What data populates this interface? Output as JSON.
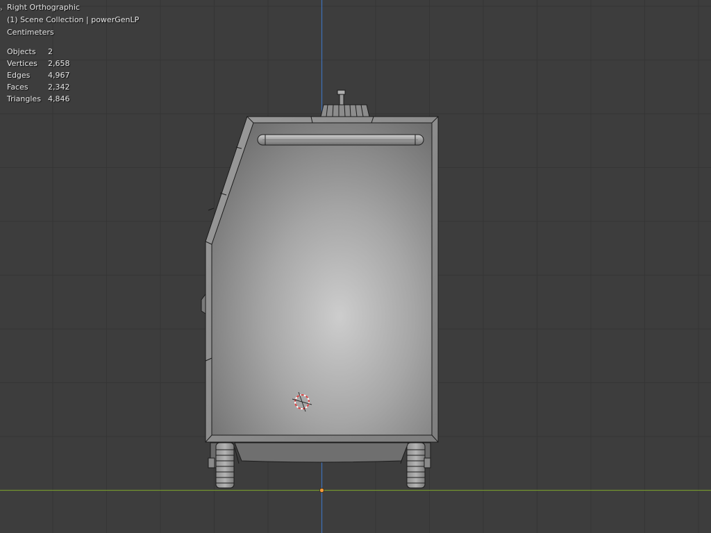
{
  "viewport": {
    "view_name": "Right Orthographic",
    "collection_line": "(1) Scene Collection | powerGenLP",
    "units": "Centimeters",
    "stats": [
      {
        "name": "Objects",
        "value": "2"
      },
      {
        "name": "Vertices",
        "value": "2,658"
      },
      {
        "name": "Edges",
        "value": "4,967"
      },
      {
        "name": "Faces",
        "value": "2,342"
      },
      {
        "name": "Triangles",
        "value": "4,846"
      }
    ],
    "colors": {
      "background": "#3d3d3d",
      "grid_line": "#353535",
      "axis_y_green": "#74942f",
      "axis_z_blue": "#3f70b8",
      "origin_dot": "#f39a3c",
      "mesh_edge": "#1b1b1b"
    }
  }
}
